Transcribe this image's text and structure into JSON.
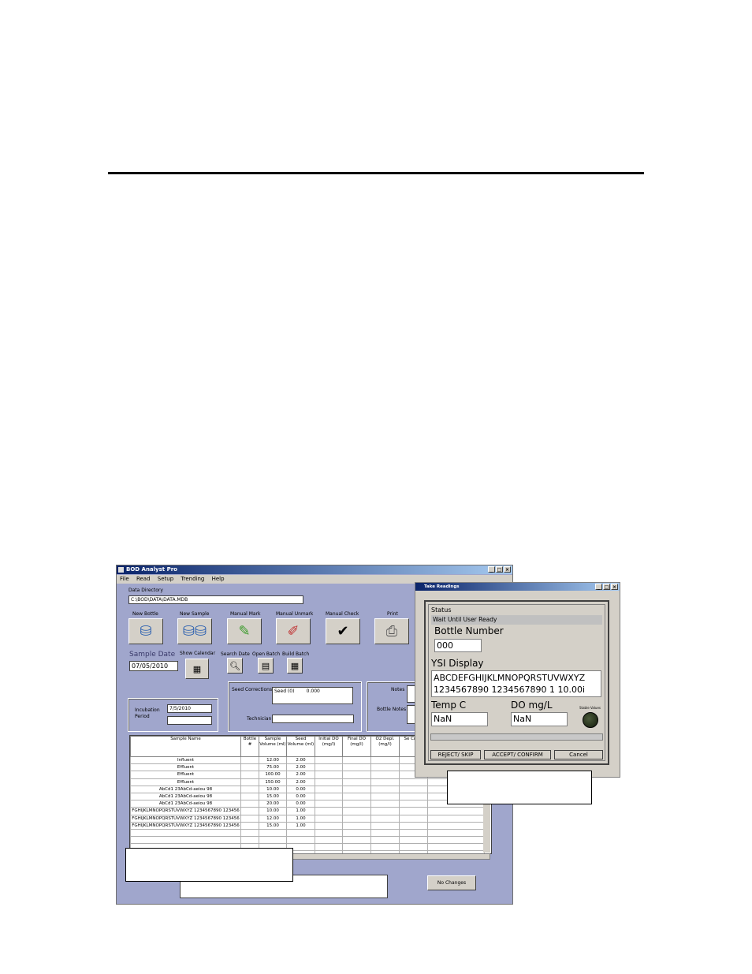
{
  "main_window": {
    "title": "BOD Analyst Pro",
    "menu": [
      "File",
      "Read",
      "Setup",
      "Trending",
      "Help"
    ],
    "data_directory_label": "Data Directory",
    "data_directory_value": "C:\\BOD\\DATA\\DATA.MDB",
    "toolbar": [
      "New Bottle",
      "New Sample",
      "Manual Mark",
      "Manual Unmark",
      "Manual Check",
      "Print"
    ],
    "sample_date_label": "Sample Date",
    "sample_date_value": "07/05/2010",
    "show_calendar_label": "Show Calendar",
    "search_date_label": "Search Date",
    "open_batch_label": "Open Batch",
    "build_batch_label": "Build Batch",
    "seed_corrections_label": "Seed Corrections",
    "seed_entry": "Seed (0)        0.000",
    "technician_label": "Technician",
    "notes_label": "Notes",
    "bottle_notes_label": "Bottle Notes",
    "incubation_period_label": "Incubation Period",
    "incubation_value": "7/5/2010",
    "no_changes_label": "No Changes",
    "table": {
      "headers": [
        "Sample Name",
        "Bottle #",
        "Sample Volume (ml)",
        "Seed Volume (ml)",
        "Initial DO (mg/l)",
        "Final DO (mg/l)",
        "O2 Depl. (mg/l)",
        "Se Cr (m"
      ],
      "rows": [
        [
          "Influent",
          "",
          "12.00",
          "2.00"
        ],
        [
          "Effluent",
          "",
          "75.00",
          "2.00"
        ],
        [
          "Effluent",
          "",
          "100.00",
          "2.00"
        ],
        [
          "Effluent",
          "",
          "150.00",
          "2.00"
        ],
        [
          "AbCd1 23AbCd-aeiou 98",
          "",
          "10.00",
          "0.00"
        ],
        [
          "AbCd1 23AbCd-aeiou 98",
          "",
          "15.00",
          "0.00"
        ],
        [
          "AbCd1 23AbCd-aeiou 98",
          "",
          "20.00",
          "0.00"
        ],
        [
          "FGHIJKLMNOPQRSTUVWXYZ 1234567890 123456",
          "",
          "10.00",
          "1.00"
        ],
        [
          "FGHIJKLMNOPQRSTUVWXYZ 1234567890 123456",
          "",
          "12.00",
          "1.00"
        ],
        [
          "FGHIJKLMNOPQRSTUVWXYZ 1234567890 123456",
          "",
          "15.00",
          "1.00"
        ]
      ]
    }
  },
  "readings_dialog": {
    "title": "Take Readings",
    "status_label": "Status",
    "status_value": "Wait Until User Ready",
    "bottle_number_label": "Bottle Number",
    "bottle_number_value": "000",
    "ysi_display_label": "YSI Display",
    "ysi_line1": "ABCDEFGHIJKLMNOPQRSTUVWXYZ",
    "ysi_line2": "1234567890 1234567890 1 10.00i",
    "temp_label": "Temp C",
    "temp_value": "NaN",
    "do_label": "DO mg/L",
    "do_value": "NaN",
    "stable_values_label": "Stable Values",
    "reject_label": "REJECT/ SKIP",
    "accept_label": "ACCEPT/ CONFIRM",
    "cancel_label": "Cancel"
  }
}
